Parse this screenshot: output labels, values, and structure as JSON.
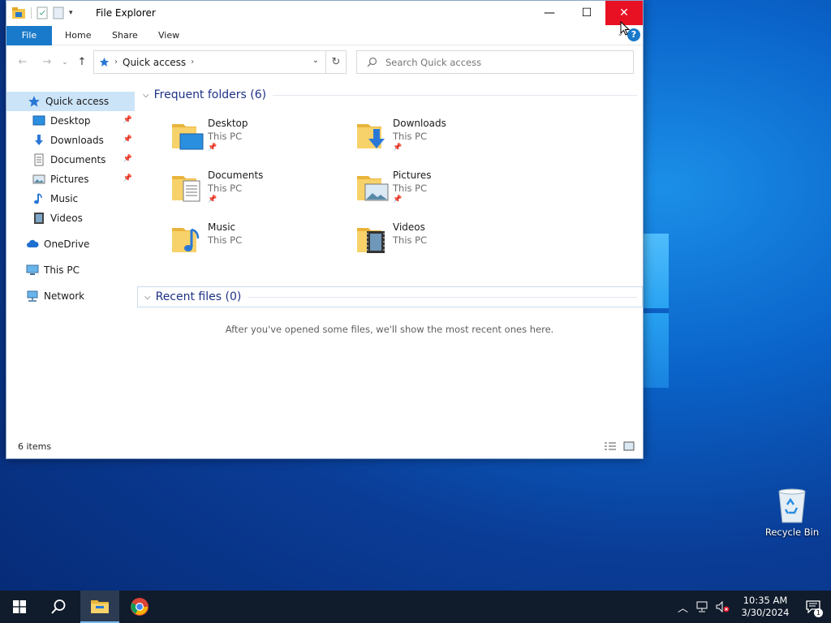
{
  "window": {
    "title": "File Explorer",
    "ribbon_tabs": [
      "File",
      "Home",
      "Share",
      "View"
    ]
  },
  "address": {
    "crumb": "Quick access",
    "search_placeholder": "Search Quick access"
  },
  "sidebar": {
    "items": [
      {
        "label": "Quick access",
        "icon": "star-icon"
      },
      {
        "label": "Desktop",
        "icon": "desktop-icon",
        "pinned": true
      },
      {
        "label": "Downloads",
        "icon": "download-icon",
        "pinned": true
      },
      {
        "label": "Documents",
        "icon": "document-icon",
        "pinned": true
      },
      {
        "label": "Pictures",
        "icon": "picture-icon",
        "pinned": true
      },
      {
        "label": "Music",
        "icon": "music-icon"
      },
      {
        "label": "Videos",
        "icon": "video-icon"
      },
      {
        "label": "OneDrive",
        "icon": "cloud-icon"
      },
      {
        "label": "This PC",
        "icon": "computer-icon"
      },
      {
        "label": "Network",
        "icon": "network-icon"
      }
    ]
  },
  "content": {
    "frequent_header": "Frequent folders (6)",
    "recent_header": "Recent files (0)",
    "recent_empty": "After you've opened some files, we'll show the most recent ones here.",
    "folders": [
      {
        "name": "Desktop",
        "location": "This PC",
        "pinned": true
      },
      {
        "name": "Downloads",
        "location": "This PC",
        "pinned": true
      },
      {
        "name": "Documents",
        "location": "This PC",
        "pinned": true
      },
      {
        "name": "Pictures",
        "location": "This PC",
        "pinned": true
      },
      {
        "name": "Music",
        "location": "This PC",
        "pinned": false
      },
      {
        "name": "Videos",
        "location": "This PC",
        "pinned": false
      }
    ]
  },
  "status": {
    "item_count": "6 items"
  },
  "desktop": {
    "recycle_bin": "Recycle Bin"
  },
  "taskbar": {
    "time": "10:35 AM",
    "date": "3/30/2024",
    "notification_count": "1"
  }
}
